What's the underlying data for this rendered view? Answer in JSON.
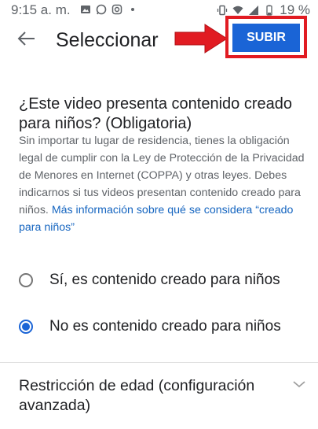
{
  "status_bar": {
    "time": "9:15 a. m.",
    "battery_percent": "19 %"
  },
  "app_bar": {
    "title": "Seleccionar",
    "upload_label": "SUBIR"
  },
  "audience": {
    "question": "¿Este video presenta contenido creado para niños? (Obligatoria)",
    "description": "Sin importar tu lugar de residencia, tienes la obligación legal de cumplir con la Ley de Protección de la Privacidad de Menores en Internet (COPPA) y otras leyes. Debes indicarnos si tus videos presentan contenido creado para niños.",
    "more_info_link": "Más información sobre qué se considera “creado para niños”",
    "options": [
      {
        "label": "Sí, es contenido creado para niños",
        "selected": false
      },
      {
        "label": "No es contenido creado para niños",
        "selected": true
      }
    ]
  },
  "age_restriction": {
    "label": "Restricción de edad (configuración avanzada)"
  },
  "colors": {
    "accent": "#1a64d6",
    "annotation_red": "#e11b22"
  }
}
